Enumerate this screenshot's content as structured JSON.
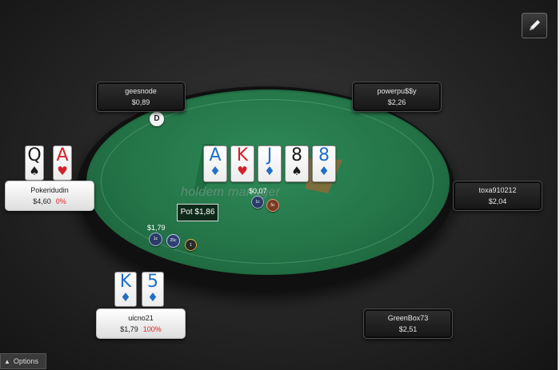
{
  "table": {
    "logo_text": "holdem manager",
    "pot_label": "Pot $1,86",
    "dealer_label": "D",
    "board": [
      {
        "rank": "A",
        "suit": "♦",
        "color": "blue"
      },
      {
        "rank": "K",
        "suit": "♥",
        "color": "red"
      },
      {
        "rank": "J",
        "suit": "♦",
        "color": "blue"
      },
      {
        "rank": "8",
        "suit": "♠",
        "color": "black"
      },
      {
        "rank": "8",
        "suit": "♦",
        "color": "blue"
      }
    ]
  },
  "players": [
    {
      "name": "geesnode",
      "stack": "$0,89"
    },
    {
      "name": "powerpu$$y",
      "stack": "$2,26"
    },
    {
      "name": "Pokeridudin",
      "stack": "$4,60",
      "percent": "0%",
      "cards": [
        {
          "rank": "Q",
          "suit": "♠",
          "color": "black"
        },
        {
          "rank": "A",
          "suit": "♥",
          "color": "red"
        }
      ]
    },
    {
      "name": "toxa910212",
      "stack": "$2,04"
    },
    {
      "name": "uicno21",
      "stack": "$1,79",
      "percent": "100%",
      "cards": [
        {
          "rank": "K",
          "suit": "♦",
          "color": "blue"
        },
        {
          "rank": "5",
          "suit": "♦",
          "color": "blue"
        }
      ]
    },
    {
      "name": "GreenBox73",
      "stack": "$2,51"
    }
  ],
  "bets": {
    "top": {
      "amount": "$0,07",
      "chips": [
        "1c",
        "5c"
      ]
    },
    "left": {
      "amount": "$1,79",
      "chips": [
        "1c",
        "25c",
        "1"
      ]
    }
  },
  "controls": {
    "options_label": "Options",
    "edit_icon": "pencil-icon"
  },
  "colors": {
    "felt": "#247448",
    "active_seat": "#ffffff",
    "percent_red": "#e0221d",
    "diamond_blue": "#1f6fc7",
    "heart_red": "#d4202a"
  }
}
